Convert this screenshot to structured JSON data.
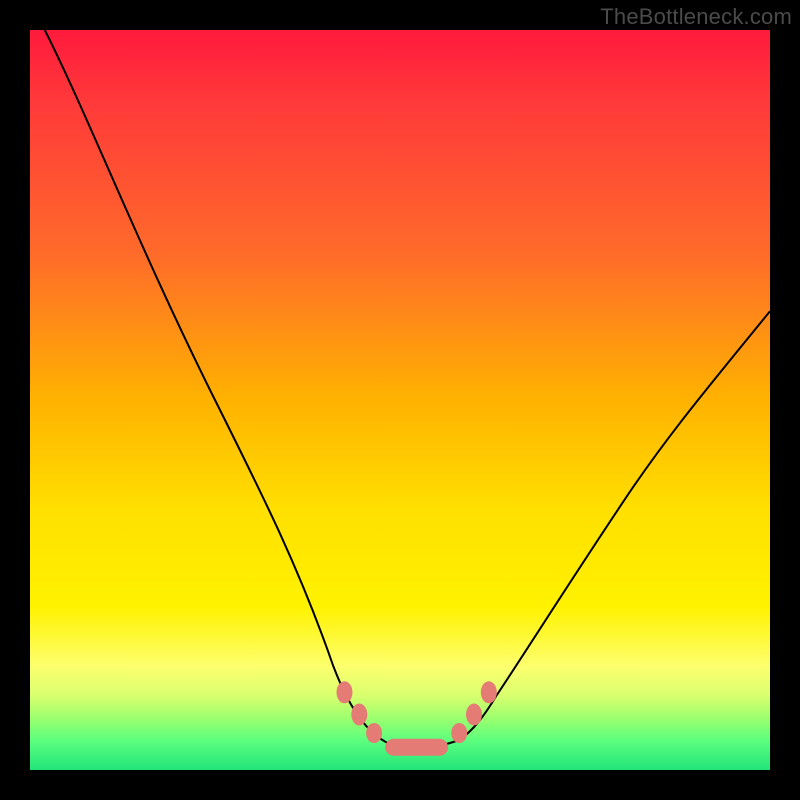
{
  "watermark": "TheBottleneck.com",
  "chart_data": {
    "type": "line",
    "title": "",
    "xlabel": "",
    "ylabel": "",
    "xlim": [
      0,
      100
    ],
    "ylim": [
      0,
      100
    ],
    "grid": false,
    "legend": false,
    "series": [
      {
        "name": "bottleneck-curve",
        "x": [
          2,
          10,
          18,
          25,
          30,
          35,
          38,
          41,
          44,
          46,
          48,
          50,
          53,
          56,
          58,
          60,
          63,
          67,
          72,
          80,
          90,
          100
        ],
        "y": [
          100,
          83,
          65,
          50,
          38,
          27,
          20,
          14,
          9,
          6,
          4,
          3,
          3,
          3,
          4,
          6,
          10,
          16,
          24,
          36,
          50,
          62
        ]
      }
    ],
    "markers": {
      "points": [
        {
          "x": 42.5,
          "y": 10.5
        },
        {
          "x": 44.5,
          "y": 7.5
        },
        {
          "x": 46.5,
          "y": 5.0
        },
        {
          "x": 58.0,
          "y": 5.0
        },
        {
          "x": 60.0,
          "y": 7.5
        },
        {
          "x": 62.0,
          "y": 10.5
        }
      ],
      "floor_pill": {
        "x0": 48.0,
        "x1": 56.5,
        "y": 3.0
      }
    },
    "background_gradient": {
      "top": "#ff1a3c",
      "mid": "#ffe000",
      "bottom": "#22e47a"
    }
  }
}
